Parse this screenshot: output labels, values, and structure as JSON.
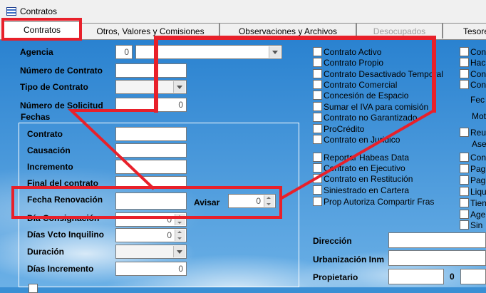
{
  "window": {
    "title": "Contratos"
  },
  "tabs": [
    {
      "label": "Contratos"
    },
    {
      "label": "Otros, Valores y Comisiones"
    },
    {
      "label": "Observaciones y Archivos"
    },
    {
      "label": "Desocupados"
    },
    {
      "label": "Tesore"
    }
  ],
  "form": {
    "agencia_label": "Agencia",
    "agencia_code": "0",
    "numero_contrato_label": "Número de Contrato",
    "tipo_contrato_label": "Tipo de Contrato",
    "numero_solicitud_label": "Número de Solicitud",
    "numero_solicitud_value": "0",
    "fechas_label": "Fechas",
    "contrato_label": "Contrato",
    "causacion_label": "Causación",
    "incremento_label": "Incremento",
    "final_contrato_label": "Final del contrato",
    "fecha_renovacion_label": "Fecha Renovación",
    "avisar_label": "Avisar",
    "avisar_value": "0",
    "dia_consignacion_label": "Día Consignación",
    "dia_consignacion_value": "0",
    "dias_vcto_label": "Días Vcto Inquilino",
    "dias_vcto_value": "0",
    "duracion_label": "Duración",
    "dias_incremento_label": "Días Incremento",
    "dias_incremento_value": "0"
  },
  "checkboxes": [
    {
      "label": "Contrato Activo"
    },
    {
      "label": "Contrato Propio"
    },
    {
      "label": "Contrato Desactivado Temporal"
    },
    {
      "label": "Contrato Comercial"
    },
    {
      "label": "Concesión de Espacio"
    },
    {
      "label": "Sumar el IVA para comisión"
    },
    {
      "label": "Contrato no Garantizado"
    },
    {
      "label": "ProCrédito"
    },
    {
      "label": "Contrato en Juridico"
    },
    {
      "label": "Reportar Habeas Data"
    },
    {
      "label": "Contrato en Ejecutivo"
    },
    {
      "label": "Contrato en Restitución"
    },
    {
      "label": "Siniestrado en Cartera"
    },
    {
      "label": "Prop Autoriza Compartir Fras"
    }
  ],
  "right_col": {
    "cb1": "Con",
    "cb2": "Hac",
    "cb3": "Con",
    "cb4": "Con",
    "t1": "Fec",
    "t2": "Mot",
    "cb5": "Reu",
    "t3": "Ase",
    "cb6": "Con",
    "cb7": "Pag",
    "cb8": "Pag",
    "cb9": "Liqu",
    "cb10": "Tien",
    "cb11": "Age",
    "cb12": "Sin"
  },
  "address": {
    "direccion_label": "Dirección",
    "urbanizacion_label": "Urbanización Inm",
    "propietario_label": "Propietario",
    "propietario_code": "0"
  },
  "colors": {
    "highlight": "#e8202a",
    "panel_bg": "#3a8fd4"
  }
}
